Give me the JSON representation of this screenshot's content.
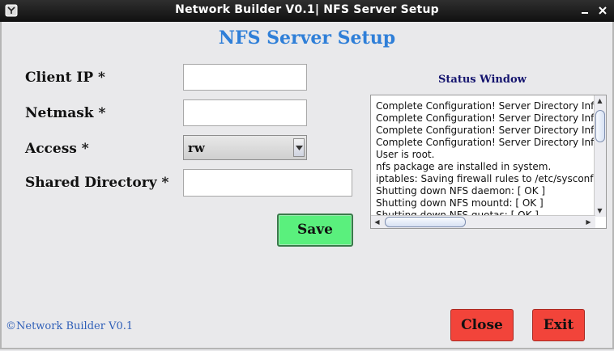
{
  "window": {
    "title": "Network Builder V0.1| NFS Server Setup"
  },
  "page": {
    "heading": "NFS Server Setup"
  },
  "form": {
    "client_ip": {
      "label": "Client IP *",
      "value": ""
    },
    "netmask": {
      "label": "Netmask *",
      "value": ""
    },
    "access": {
      "label": "Access *",
      "value": "rw"
    },
    "shared_directory": {
      "label": "Shared Directory *",
      "value": ""
    },
    "save_label": "Save"
  },
  "status": {
    "title": "Status Window",
    "lines": [
      "Complete Configuration! Server Directory Inf",
      "Complete Configuration! Server Directory Inf",
      "Complete Configuration! Server Directory Inf",
      "Complete Configuration! Server Directory Inf",
      "User is root.",
      "nfs package are installed in system.",
      "iptables: Saving firewall rules to /etc/sysconf",
      "Shutting down NFS daemon: [  OK  ]",
      "Shutting down NFS mountd: [  OK  ]",
      "Shutting down NFS quotas: [  OK  ]"
    ]
  },
  "footer": {
    "text": "©Network Builder V0.1"
  },
  "buttons": {
    "close": "Close",
    "exit": "Exit"
  },
  "colors": {
    "heading": "#2f7fd8",
    "save": "#5af07d",
    "danger": "#f2443a",
    "status_title": "#14146e",
    "footer": "#2f5fb8"
  },
  "icons": {
    "app": "app-icon",
    "minimize": "minimize-icon",
    "close": "close-icon"
  }
}
